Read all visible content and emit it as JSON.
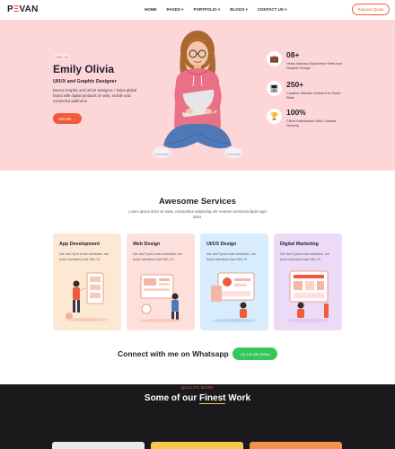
{
  "header": {
    "logo_prefix": "P",
    "logo_accent": "Ξ",
    "logo_suffix": "VAN",
    "nav": [
      "HOME",
      "PAGES ▾",
      "PORTFOLIO ▾",
      "BLOGS ▾",
      "CONTACT US ▾"
    ],
    "quote_label": "Request Quote"
  },
  "hero": {
    "badge": "Hello, I'm",
    "name": "Emily Olivia",
    "role": "UI/UX and Graphic Designer",
    "description": "Reeco Graphic and UI/UX Designer. I helps global brand with digital products on web, mobile and connected platforms.",
    "hire_label": "Hire Me →",
    "stats": [
      {
        "icon": "briefcase-icon",
        "glyph": "💼",
        "value": "08+",
        "label": "Years Industry Experience Web and Graphic Design"
      },
      {
        "icon": "monitor-icon",
        "glyph": "🖥",
        "value": "250+",
        "label": "Creative Website Deliverd to World Wide"
      },
      {
        "icon": "trophy-icon",
        "glyph": "🏆",
        "value": "100%",
        "label": "Client Satisfaction With Creative Delivery"
      }
    ]
  },
  "services": {
    "title": "Awesome Services",
    "subtitle": "Lorem ipsum dolor sit amet, consectetur adipiscing elit. Aenean commodo ligula eget dolor.",
    "cards": [
      {
        "title": "App Development",
        "desc": "We don't just build websites, we build websites that SELLS",
        "bg": "#fde8d4"
      },
      {
        "title": "Web Design",
        "desc": "We don't just build websites, we build websites that SELLS",
        "bg": "#fde0dc"
      },
      {
        "title": "UI/UX Design",
        "desc": "We don't just build websites, we build websites that SELLS",
        "bg": "#d7ecfc"
      },
      {
        "title": "Digital Marketing",
        "desc": "We don't just build websites, we build websites that SELLS",
        "bg": "#ecdaf6"
      }
    ]
  },
  "whatsapp": {
    "text": "Connect with me on Whatsapp",
    "button": "+91 132 456 3699 ▸"
  },
  "work": {
    "eyebrow": "QUALITY WORK",
    "title_prefix": "Some of our ",
    "title_highlight": "Finest",
    "title_suffix": " Work"
  },
  "colors": {
    "accent": "#f25a3c",
    "hero_bg": "#fdd6d8",
    "whatsapp": "#34c759",
    "dark_bg": "#1a1a1c"
  }
}
